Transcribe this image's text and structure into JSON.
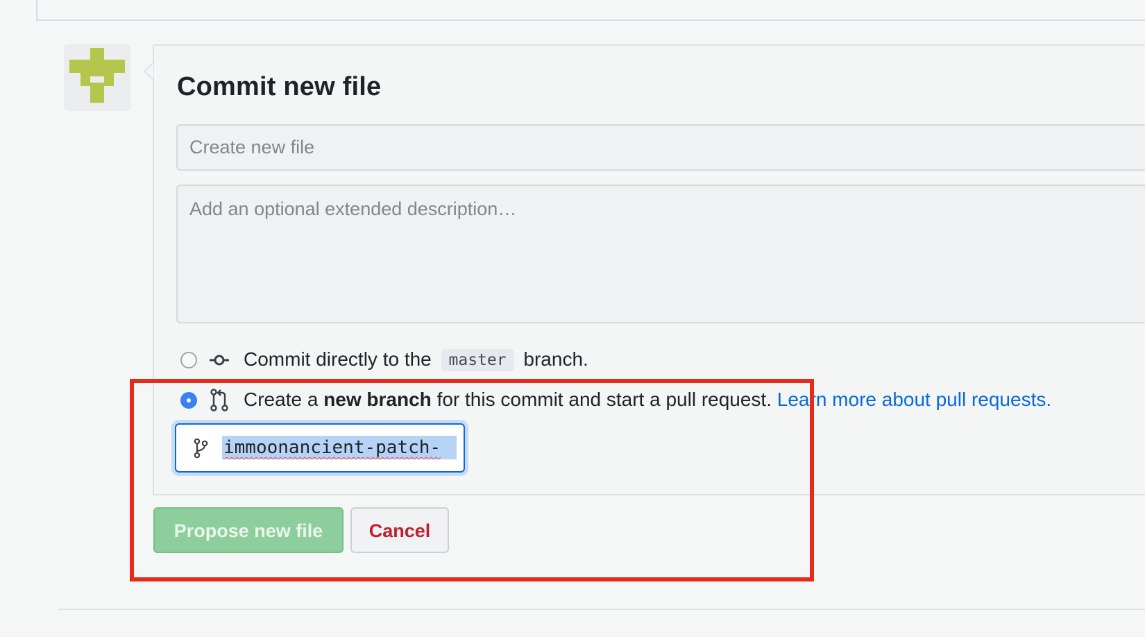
{
  "commit_form": {
    "title": "Commit new file",
    "summary_placeholder": "Create new file",
    "description_placeholder": "Add an optional extended description…",
    "option_direct": {
      "prefix": "Commit directly to the",
      "branch": "master",
      "suffix": "branch."
    },
    "option_new_branch": {
      "prefix": "Create a",
      "emphasis": "new branch",
      "suffix": "for this commit and start a pull request.",
      "link": "Learn more about pull requests."
    },
    "new_branch_name": "immoonancient-patch-",
    "propose_label": "Propose new file",
    "cancel_label": "Cancel"
  },
  "colors": {
    "accent_blue": "#0969da",
    "selected_radio": "#3b82f0",
    "propose_button": "#8dce9c",
    "cancel_text": "#c11f2f",
    "highlight_box": "#e42b1c",
    "avatar_identicon": "#b5c64c"
  },
  "icons": {
    "avatar": "identicon-avatar",
    "commit": "git-commit-icon",
    "pull_request": "git-pull-request-icon",
    "branch": "git-branch-icon"
  },
  "state": {
    "selected_option": "new_branch"
  }
}
